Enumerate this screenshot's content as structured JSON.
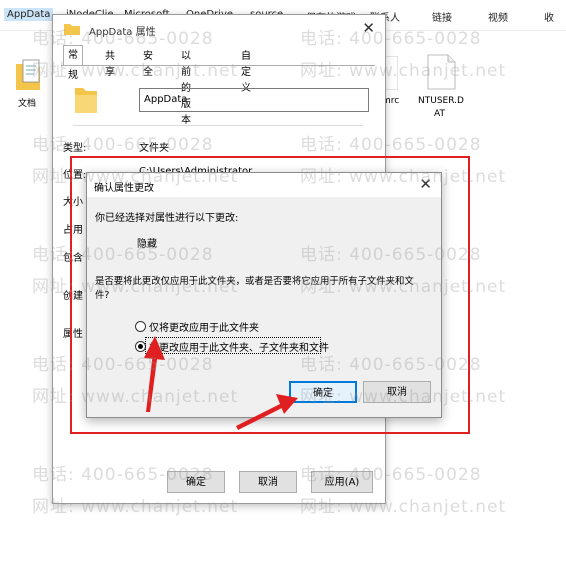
{
  "explorer_header": {
    "items": [
      "AppData",
      "iNodeClie",
      "Microsoft",
      "OneDrive",
      "source",
      "保存的游戏",
      "联系人",
      "链接",
      "视频",
      "收"
    ]
  },
  "desktop_files": {
    "left_icon_label": "文档",
    "right_icon1_label": "mrc",
    "right_icon2_label_line1": "NTUSER.D",
    "right_icon2_label_line2": "AT"
  },
  "properties_dialog": {
    "title": "AppData 属性",
    "tabs": [
      "常规",
      "共享",
      "安全",
      "以前的版本",
      "自定义"
    ],
    "folder_name": "AppData",
    "type_label": "类型:",
    "type_value": "文件夹",
    "location_label": "位置:",
    "location_value": "C:\\Users\\Administrator",
    "size_label": "大小",
    "occupied_label": "占用",
    "contains_label": "包含",
    "created_label": "创建",
    "attributes_label": "属性",
    "ok_button": "确定",
    "cancel_button": "取消",
    "apply_button": "应用(A)"
  },
  "confirm_dialog": {
    "title": "确认属性更改",
    "intro": "你已经选择对属性进行以下更改:",
    "change": "隐藏",
    "question_line1": "是否要将此更改仅应用于此文件夹，或者是否要将它应用于所有子文件夹和文",
    "question_line2": "件?",
    "option1": "仅将更改应用于此文件夹",
    "option2": "将更改应用于此文件夹、子文件夹和文件",
    "selected_option": 2,
    "ok_button": "确定",
    "cancel_button": "取消"
  },
  "watermark": {
    "phone": "电话: 400-665-0028",
    "url": "网址: www.chanjet.net"
  },
  "colors": {
    "annotation_red": "#e02020",
    "button_default_blue": "#0078d7"
  }
}
